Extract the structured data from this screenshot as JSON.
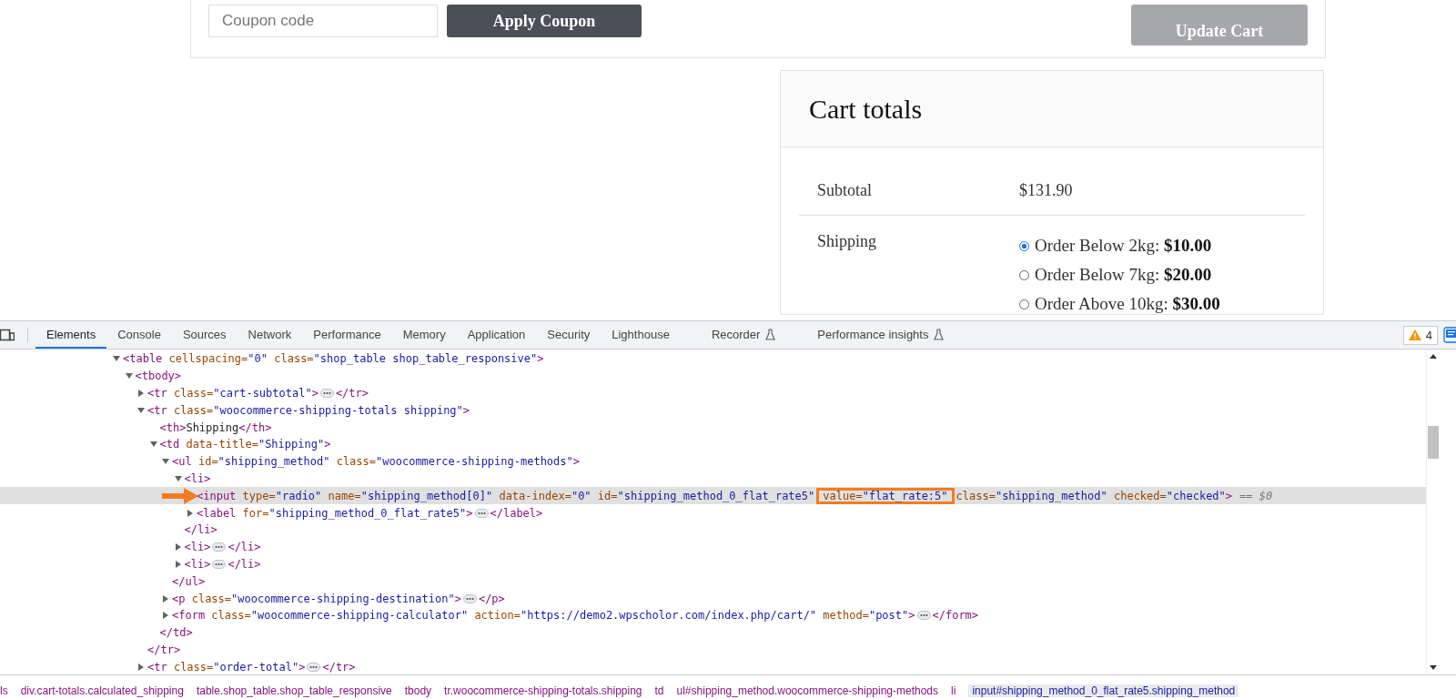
{
  "page": {
    "coupon": {
      "placeholder": "Coupon code"
    },
    "apply_button": "Apply Coupon",
    "update_button": "Update Cart",
    "cart_totals": {
      "title": "Cart totals",
      "subtotal_label": "Subtotal",
      "subtotal_value": "$131.90",
      "shipping_label": "Shipping",
      "shipping_options": [
        {
          "label": "Order Below 2kg: **$10.00**",
          "selected": true
        },
        {
          "label": "Order Below 7kg: **$20.00**",
          "selected": false
        },
        {
          "label": "Order Above 10kg: **$30.00**",
          "selected": false
        }
      ]
    }
  },
  "devtools": {
    "tabs": [
      {
        "label": "Elements",
        "selected": true,
        "experimental": false
      },
      {
        "label": "Console",
        "selected": false,
        "experimental": false
      },
      {
        "label": "Sources",
        "selected": false,
        "experimental": false
      },
      {
        "label": "Network",
        "selected": false,
        "experimental": false
      },
      {
        "label": "Performance",
        "selected": false,
        "experimental": false
      },
      {
        "label": "Memory",
        "selected": false,
        "experimental": false
      },
      {
        "label": "Application",
        "selected": false,
        "experimental": false
      },
      {
        "label": "Security",
        "selected": false,
        "experimental": false
      },
      {
        "label": "Lighthouse",
        "selected": false,
        "experimental": false
      },
      {
        "label": "Recorder",
        "selected": false,
        "experimental": true
      },
      {
        "label": "Performance insights",
        "selected": false,
        "experimental": true
      }
    ],
    "warning_count": "4",
    "tree": [
      {
        "code": "<table cellspacing=\"0\" class=\"shop_table shop_table_responsive\">",
        "expanded": true,
        "selected": false,
        "children": [
          {
            "code": "<tbody>",
            "expanded": true,
            "selected": false,
            "children": [
              {
                "code": "<tr class=\"cart-subtotal\">",
                "expanded": false,
                "close": "</tr>",
                "selected": false
              },
              {
                "code": "<tr class=\"woocommerce-shipping-totals shipping\">",
                "expanded": true,
                "end": "</tr>",
                "selected": false,
                "children": [
                  {
                    "code": "<th>Shipping</th>",
                    "selected": false
                  },
                  {
                    "code": "<td data-title=\"Shipping\">",
                    "expanded": true,
                    "end": "</td>",
                    "selected": false,
                    "children": [
                      {
                        "code": "<ul id=\"shipping_method\" class=\"woocommerce-shipping-methods\">",
                        "expanded": true,
                        "end": "</ul>",
                        "selected": false,
                        "children": [
                          {
                            "code": "<li>",
                            "expanded": true,
                            "end": "</li>",
                            "selected": false,
                            "children": [
                              {
                                "code": "<input type=\"radio\" name=\"shipping_method[0]\" data-index=\"0\" id=\"shipping_method_0_flat_rate5\"",
                                "code_boxed": "value=\"flat_rate:5\"",
                                "code_rest": "class=\"shipping_method\" checked=\"checked\">",
                                "console_ref": "== $0",
                                "selected": true
                              },
                              {
                                "code": "<label for=\"shipping_method_0_flat_rate5\">",
                                "expanded": false,
                                "close": "</label>",
                                "selected": false
                              }
                            ]
                          },
                          {
                            "code": "<li>",
                            "expanded": false,
                            "close": "</li>",
                            "selected": false
                          },
                          {
                            "code": "<li>",
                            "expanded": false,
                            "close": "</li>",
                            "selected": false
                          }
                        ]
                      },
                      {
                        "code": "<p class=\"woocommerce-shipping-destination\">",
                        "expanded": false,
                        "close": "</p>",
                        "selected": false
                      },
                      {
                        "code": "<form class=\"woocommerce-shipping-calculator\" action=\"https://demo2.wpscholor.com/index.php/cart/\" method=\"post\">",
                        "expanded": false,
                        "close": "</form>",
                        "selected": false
                      }
                    ]
                  }
                ]
              },
              {
                "code": "<tr class=\"order-total\">",
                "expanded": false,
                "close": "</tr>",
                "selected": false
              }
            ]
          }
        ]
      }
    ],
    "breadcrumbs": [
      {
        "label": "ls",
        "selected": false
      },
      {
        "label": "div.cart-totals.calculated_shipping",
        "selected": false
      },
      {
        "label": "table.shop_table.shop_table_responsive",
        "selected": false
      },
      {
        "label": "tbody",
        "selected": false
      },
      {
        "label": "tr.woocommerce-shipping-totals.shipping",
        "selected": false
      },
      {
        "label": "td",
        "selected": false
      },
      {
        "label": "ul#shipping_method.woocommerce-shipping-methods",
        "selected": false
      },
      {
        "label": "li",
        "selected": false
      },
      {
        "label": "input#shipping_method_0_flat_rate5.shipping_method",
        "selected": true
      }
    ]
  }
}
